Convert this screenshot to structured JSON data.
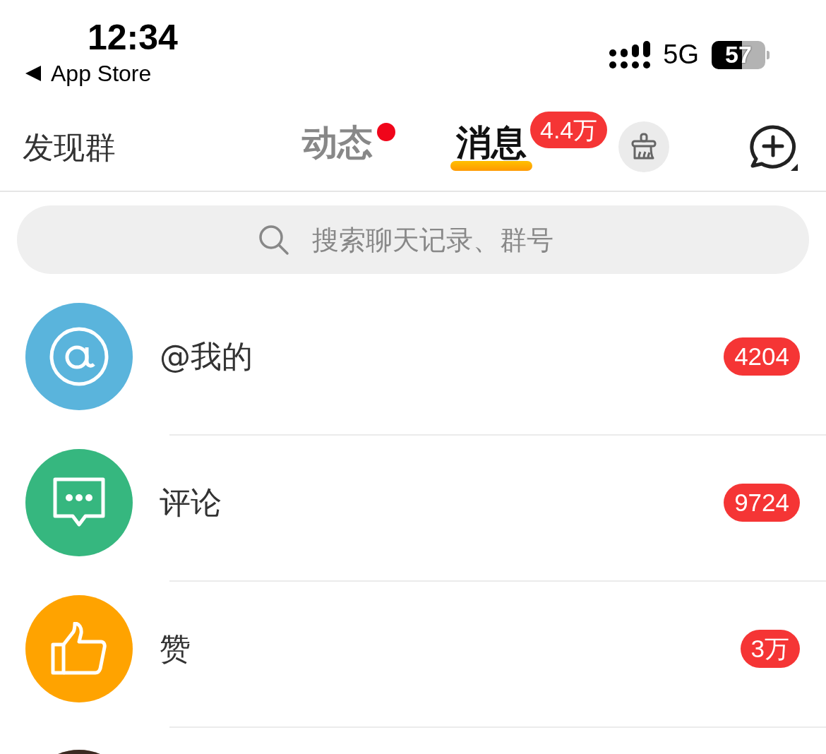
{
  "status_bar": {
    "time": "12:34",
    "back_label": "App Store",
    "network": "5G",
    "battery": "57"
  },
  "nav": {
    "left_button": "发现群",
    "tabs": [
      {
        "label": "动态",
        "selected": false,
        "dot": true
      },
      {
        "label": "消息",
        "selected": true,
        "badge": "4.4万"
      }
    ]
  },
  "search": {
    "placeholder": "搜索聊天记录、群号"
  },
  "rows": [
    {
      "kind": "mention",
      "title": "@我的",
      "badge": "4204",
      "color": "#5ab4dc"
    },
    {
      "kind": "comment",
      "title": "评论",
      "badge": "9724",
      "color": "#36b77f"
    },
    {
      "kind": "like",
      "title": "赞",
      "badge": "3万",
      "color": "#ffa300"
    },
    {
      "kind": "contact"
    }
  ]
}
